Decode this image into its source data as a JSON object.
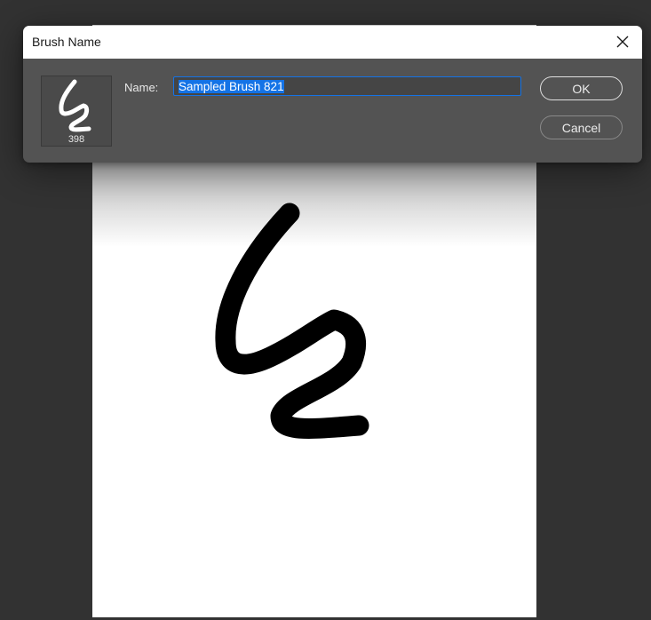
{
  "dialog": {
    "title": "Brush Name",
    "close_icon": "close-icon",
    "preview": {
      "icon": "brush-tip-preview-icon",
      "size": "398"
    },
    "name_label": "Name:",
    "name_value": "Sampled Brush 821",
    "ok_label": "OK",
    "cancel_label": "Cancel"
  },
  "colors": {
    "background": "#323232",
    "dialog_body": "#535353",
    "accent": "#1473e6",
    "stroke": "#000000"
  }
}
